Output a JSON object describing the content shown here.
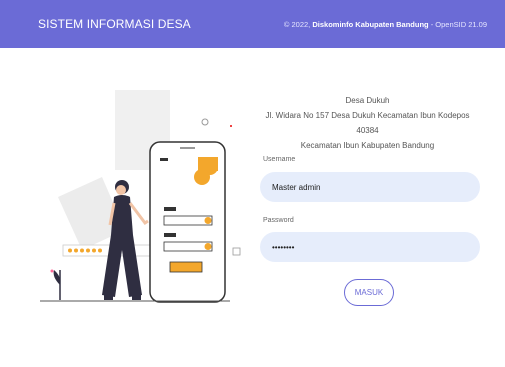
{
  "header": {
    "brand": "SISTEM INFORMASI DESA",
    "copyright_prefix": "© 2022,",
    "org": "Diskominfo Kabupaten Bandung",
    "version_suffix": "- OpenSID 21.09"
  },
  "village": {
    "name": "Desa Dukuh",
    "address": "Jl. Widara No 157 Desa Dukuh Kecamatan Ibun Kodepos 40384",
    "region": "Kecamatan Ibun Kabupaten Bandung"
  },
  "form": {
    "username_label": "Username",
    "username_value": "Master admin",
    "password_label": "Password",
    "password_value": "••••••••",
    "submit_label": "MASUK"
  },
  "colors": {
    "primary": "#6b6bd6",
    "input_bg": "#e6edfb",
    "accent": "#f3a72c"
  }
}
